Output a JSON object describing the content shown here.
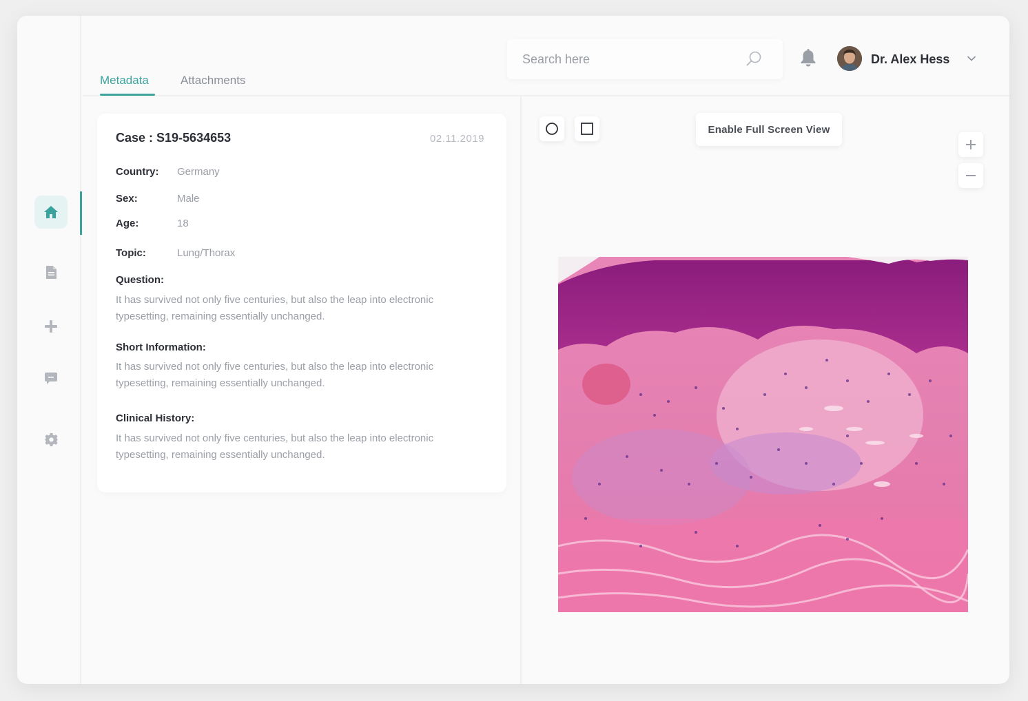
{
  "tabs": [
    {
      "label": "Metadata",
      "active": true
    },
    {
      "label": "Attachments",
      "active": false
    }
  ],
  "search": {
    "placeholder": "Search here"
  },
  "user": {
    "name": "Dr. Alex Hess"
  },
  "sidebar": {
    "items": [
      {
        "icon": "home-icon",
        "active": true
      },
      {
        "icon": "document-icon",
        "active": false
      },
      {
        "icon": "plus-icon",
        "active": false
      },
      {
        "icon": "chat-icon",
        "active": false
      },
      {
        "icon": "gear-icon",
        "active": false
      }
    ]
  },
  "case": {
    "title": "Case : S19-5634653",
    "date": "02.11.2019",
    "fields": [
      {
        "label": "Country:",
        "value": "Germany"
      },
      {
        "label": "Sex:",
        "value": "Male"
      },
      {
        "label": "Age:",
        "value": "18"
      },
      {
        "label": "Topic:",
        "value": "Lung/Thorax"
      }
    ],
    "sections": [
      {
        "label": "Question:",
        "text": "It has survived not only five centuries, but also the leap into electronic typesetting, remaining essentially unchanged."
      },
      {
        "label": "Short Information:",
        "text": "It has survived not only five centuries, but also the leap into electronic typesetting, remaining essentially unchanged."
      },
      {
        "label": "Clinical History:",
        "text": "It has survived not only five centuries, but also the leap into electronic typesetting, remaining essentially unchanged."
      }
    ]
  },
  "viewer": {
    "fullscreen_label": "Enable Full Screen View",
    "tools": [
      "circle-tool-icon",
      "square-tool-icon"
    ],
    "zoom": [
      "zoom-in-icon",
      "zoom-out-icon"
    ]
  },
  "colors": {
    "accent": "#3aa39e",
    "text_dark": "#2c2f36",
    "text_muted": "#9a9ea6"
  }
}
